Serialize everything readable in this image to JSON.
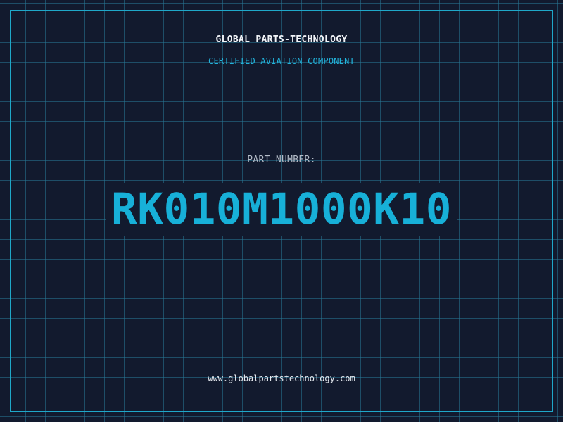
{
  "header": {
    "company_name": "GLOBAL PARTS-TECHNOLOGY",
    "subtitle": "CERTIFIED AVIATION COMPONENT"
  },
  "part": {
    "label": "PART NUMBER:",
    "number": "RK010M1000K10"
  },
  "footer": {
    "website": "www.globalpartstechnology.com"
  },
  "colors": {
    "background": "#121a2e",
    "grid": "#28788f",
    "accent": "#17b0d8",
    "frame": "#1fa8c9"
  }
}
